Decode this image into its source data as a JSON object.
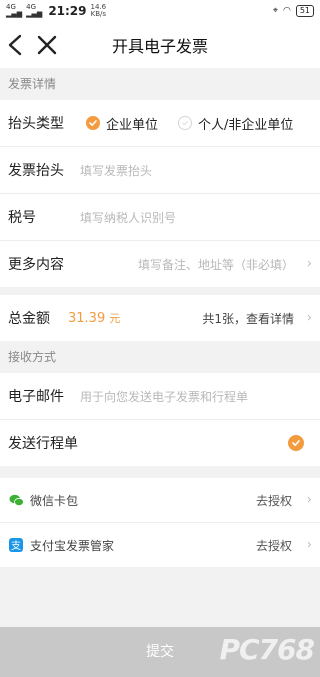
{
  "status": {
    "sig1": "4G",
    "sig2": "4G",
    "time": "21:29",
    "speed_val": "14.6",
    "speed_unit": "KB/s",
    "battery": "51"
  },
  "header": {
    "title": "开具电子发票"
  },
  "details": {
    "section_title": "发票详情",
    "type_label": "抬头类型",
    "type_options": [
      "企业单位",
      "个人/非企业单位"
    ],
    "heading_label": "发票抬头",
    "heading_placeholder": "填写发票抬头",
    "tax_label": "税号",
    "tax_placeholder": "填写纳税人识别号",
    "more_label": "更多内容",
    "more_placeholder": "填写备注、地址等（非必填）"
  },
  "total": {
    "label": "总金额",
    "amount": "31.39",
    "unit": "元",
    "info": "共1张，查看详情"
  },
  "receive": {
    "section_title": "接收方式",
    "email_label": "电子邮件",
    "email_placeholder": "用于向您发送电子发票和行程单",
    "itinerary_label": "发送行程单"
  },
  "auth": [
    {
      "name": "微信卡包",
      "action": "去授权",
      "icon": "wechat-icon"
    },
    {
      "name": "支付宝发票管家",
      "action": "去授权",
      "icon": "alipay-icon"
    }
  ],
  "footer": {
    "submit": "提交"
  },
  "watermark": "PC768",
  "colors": {
    "accent": "#f39b3f"
  }
}
